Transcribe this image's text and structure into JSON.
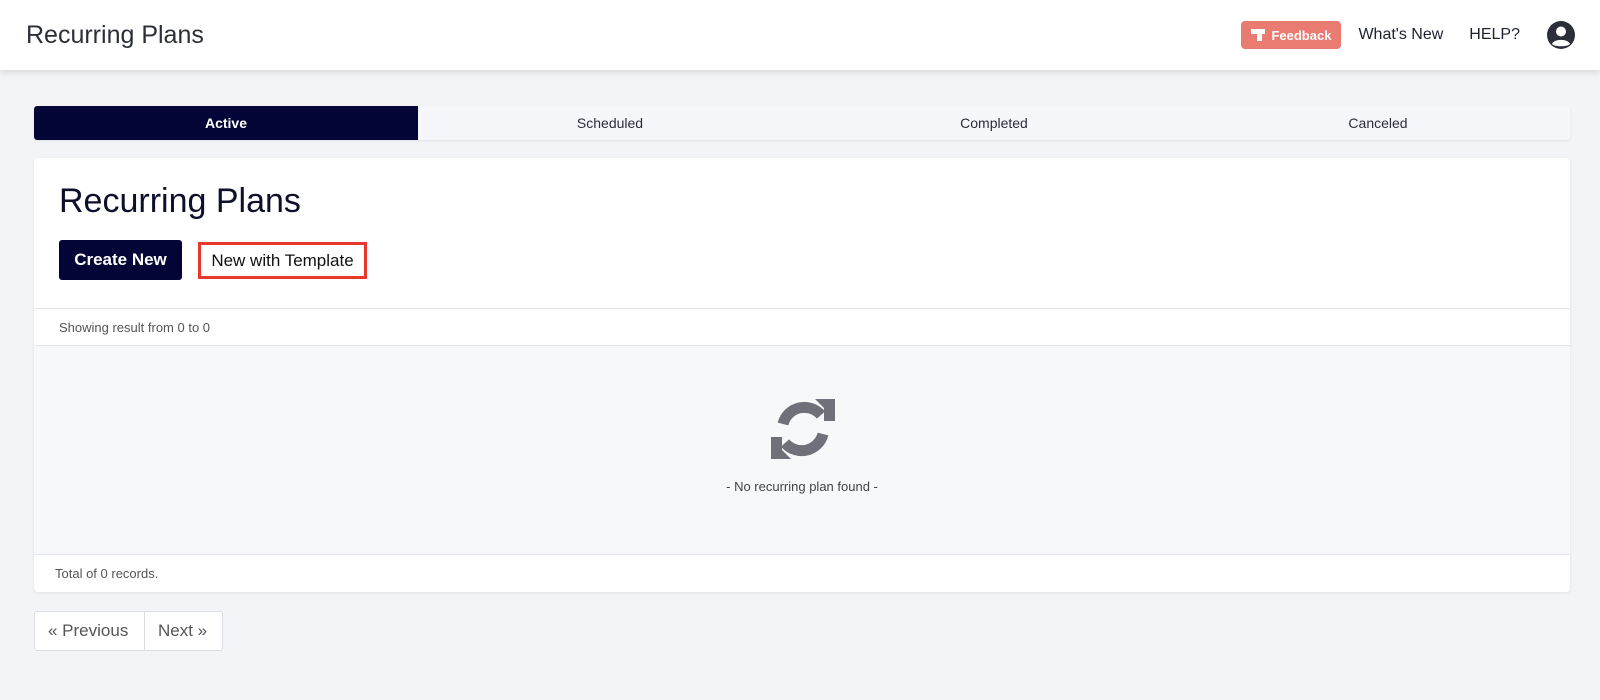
{
  "header": {
    "title": "Recurring Plans",
    "feedback_label": "Feedback",
    "whats_new_label": "What's New",
    "help_label": "HELP?",
    "icons": {
      "feedback": "flag-icon",
      "avatar": "user-circle-icon"
    },
    "colors": {
      "feedback_bg": "#ea7b71"
    }
  },
  "tabs": [
    {
      "label": "Active",
      "active": true
    },
    {
      "label": "Scheduled",
      "active": false
    },
    {
      "label": "Completed",
      "active": false
    },
    {
      "label": "Canceled",
      "active": false
    }
  ],
  "main": {
    "title": "Recurring Plans",
    "create_new_label": "Create New",
    "new_with_template_label": "New with Template",
    "showing_result": "Showing result from 0 to 0",
    "empty_icon": "sync-icon",
    "empty_message": "- No recurring plan found -",
    "total_records": "Total of 0 records."
  },
  "pagination": {
    "previous_label": "« Previous",
    "next_label": "Next »"
  },
  "colors": {
    "primary": "#040537",
    "highlight_border": "#e8382c",
    "background": "#f3f4f8"
  }
}
